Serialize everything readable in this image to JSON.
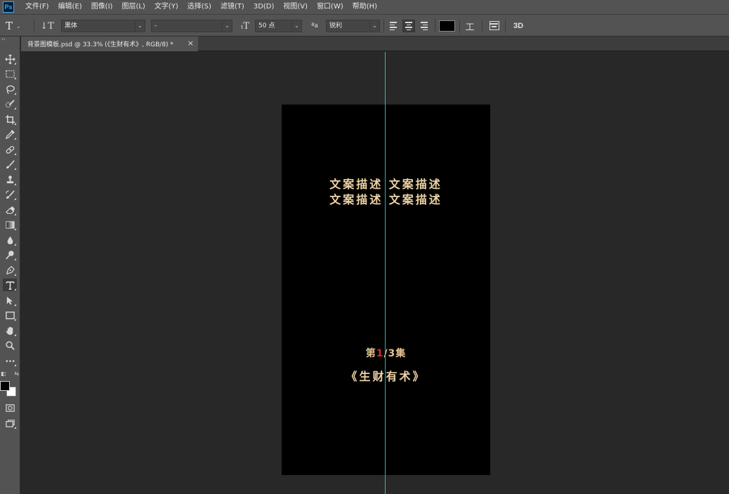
{
  "app": {
    "logo": "Ps"
  },
  "menu": [
    "文件(F)",
    "编辑(E)",
    "图像(I)",
    "图层(L)",
    "文字(Y)",
    "选择(S)",
    "滤镜(T)",
    "3D(D)",
    "视图(V)",
    "窗口(W)",
    "帮助(H)"
  ],
  "options": {
    "font_family": "黑体",
    "font_style": "-",
    "font_size": "50 点",
    "antialias": "锐利",
    "antialias_icon_text": "ªa",
    "btn3d": "3D",
    "text_color": "#000000"
  },
  "tools": [
    "move-tool",
    "marquee-tool",
    "lasso-tool",
    "quick-select-tool",
    "crop-tool",
    "eyedropper-tool",
    "healing-brush-tool",
    "brush-tool",
    "clone-stamp-tool",
    "history-brush-tool",
    "eraser-tool",
    "gradient-tool",
    "blur-tool",
    "dodge-tool",
    "pen-tool",
    "type-tool",
    "path-selection-tool",
    "rectangle-tool",
    "hand-tool",
    "zoom-tool",
    "edit-toolbar",
    "quick-mask",
    "screen-mode"
  ],
  "document": {
    "tab_title": "背景图模板.psd @ 33.3% (《生财有术》, RGB/8) *",
    "close": "×"
  },
  "artboard": {
    "copy_line_1": "文案描述 文案描述",
    "copy_line_2": "文案描述 文案描述",
    "episode_prefix": "第",
    "episode_current": "1",
    "episode_suffix": "/3集",
    "title": "《生财有术》"
  },
  "colors": {
    "text_gold": "#ecd3a4",
    "episode_red": "#e0242a",
    "guide": "#2fd1d1",
    "foreground": "#000000",
    "background": "#ffffff"
  }
}
